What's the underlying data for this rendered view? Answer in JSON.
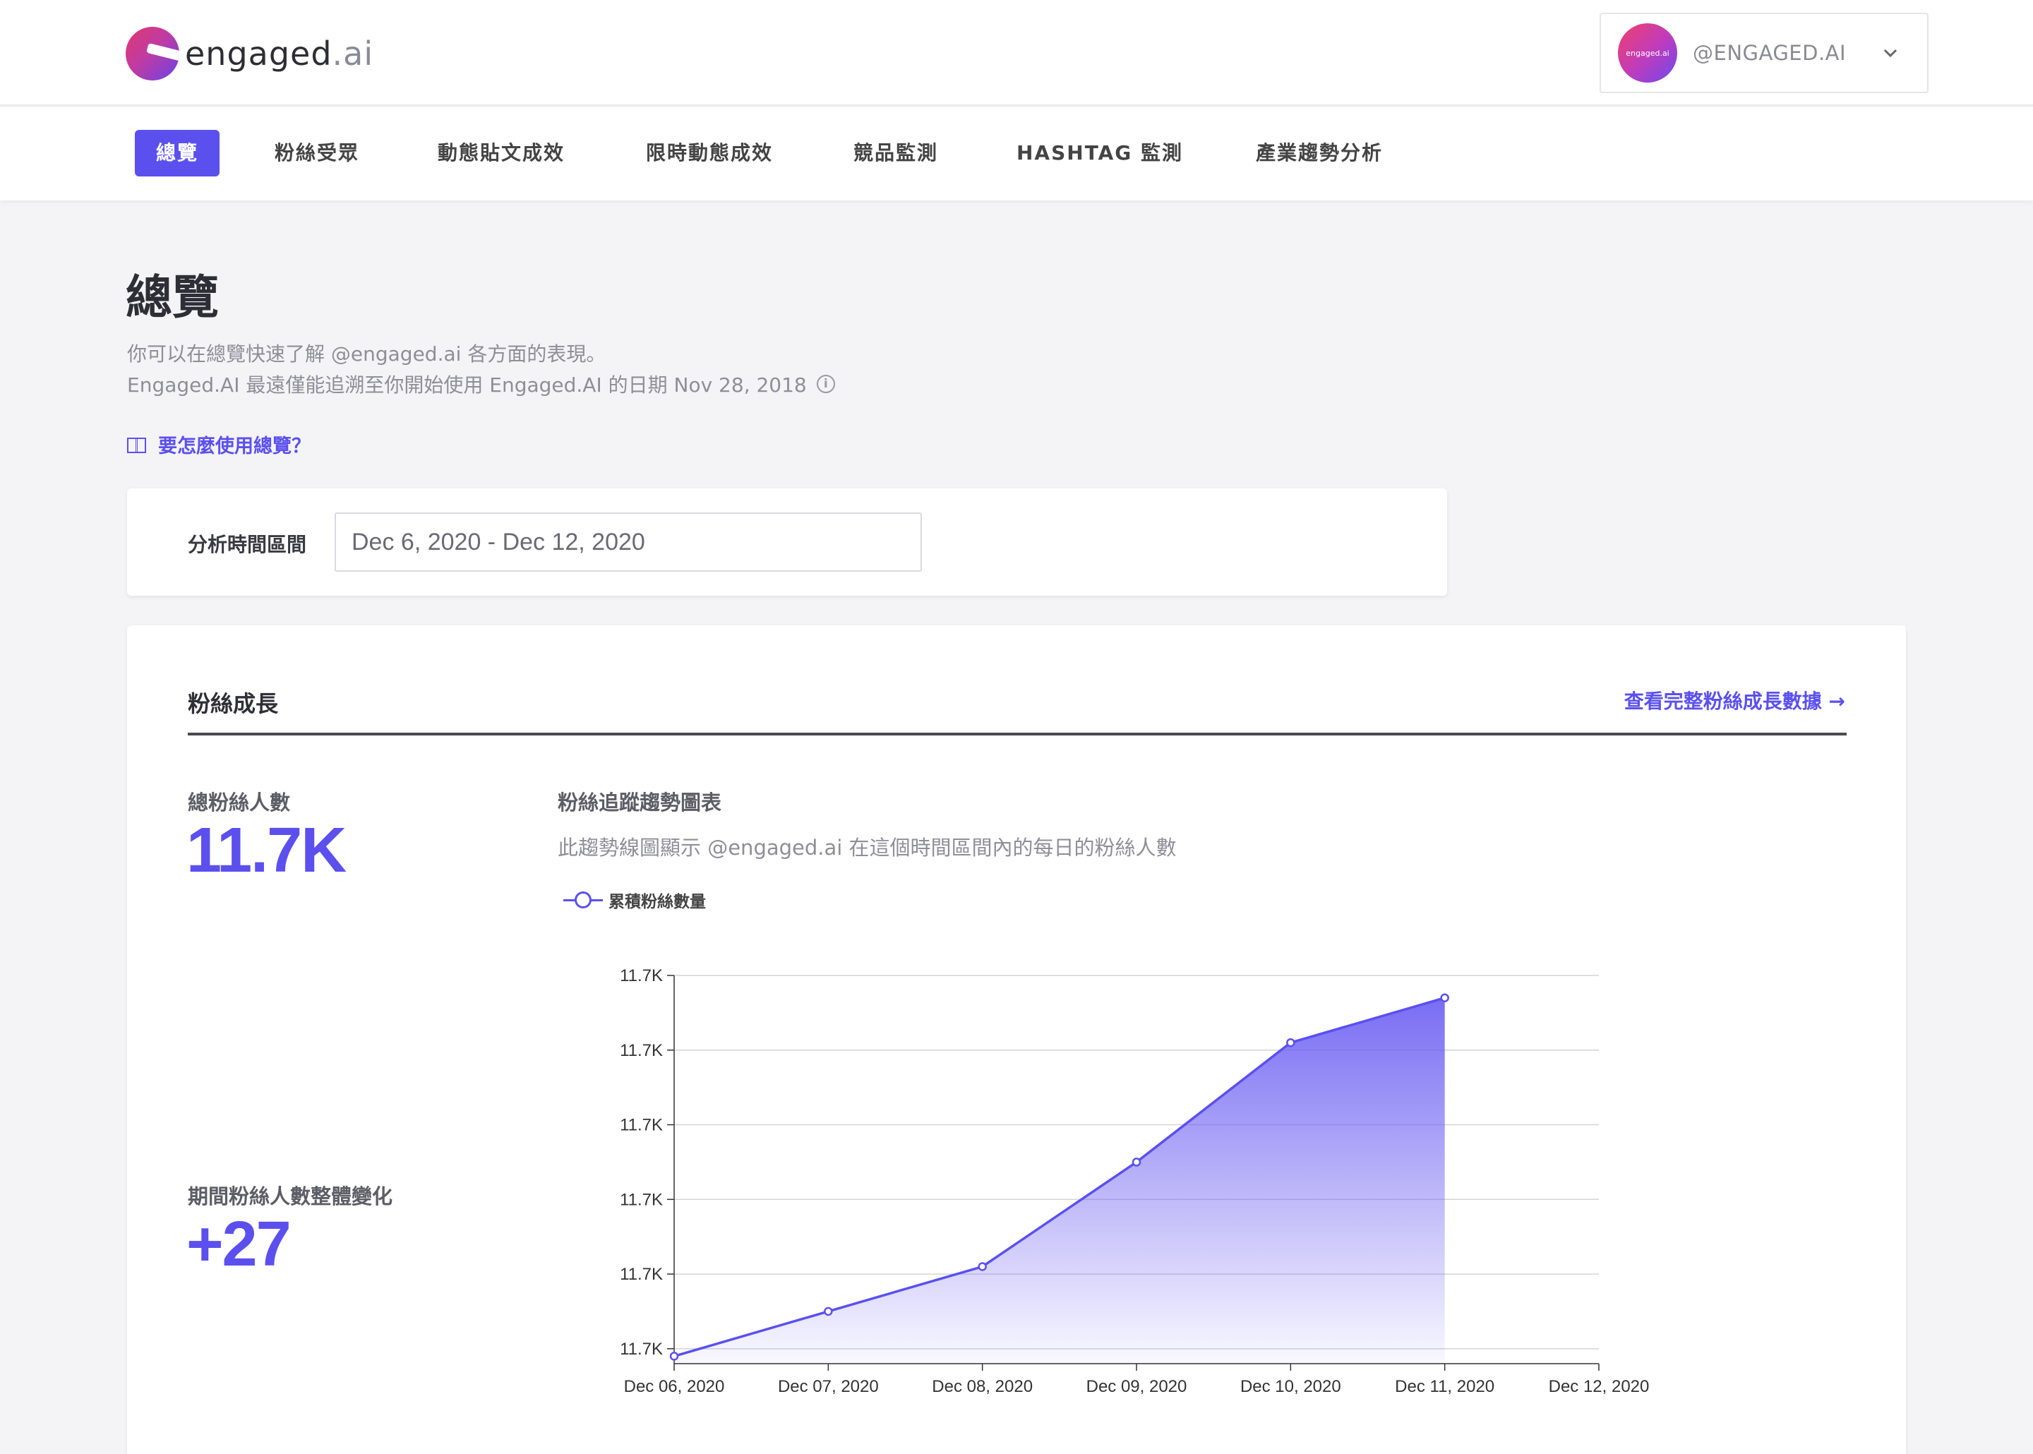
{
  "brand": {
    "logo_text": "engaged",
    "logo_suffix": ".ai"
  },
  "account": {
    "avatar_text": "engaged.ai",
    "name": "@ENGAGED.AI"
  },
  "nav": {
    "items": [
      {
        "label": "總覽"
      },
      {
        "label": "粉絲受眾"
      },
      {
        "label": "動態貼文成效"
      },
      {
        "label": "限時動態成效"
      },
      {
        "label": "競品監測"
      },
      {
        "label": "HASHTAG 監測"
      },
      {
        "label": "產業趨勢分析"
      }
    ]
  },
  "page": {
    "title": "總覽",
    "desc1": "你可以在總覽快速了解 @engaged.ai 各方面的表現。",
    "desc2": "Engaged.AI 最遠僅能追溯至你開始使用 Engaged.AI 的日期 Nov 28, 2018",
    "howto": "要怎麼使用總覽？"
  },
  "range": {
    "label": "分析時間區間",
    "value": "Dec 6, 2020 - Dec 12, 2020"
  },
  "growth": {
    "title": "粉絲成長",
    "link": "查看完整粉絲成長數據 →",
    "total_label": "總粉絲人數",
    "total_value": "11.7K",
    "change_label": "期間粉絲人數整體變化",
    "change_value": "+27",
    "chart_title": "粉絲追蹤趨勢圖表",
    "chart_sub": "此趨勢線圖顯示 @engaged.ai 在這個時間區間內的每日的粉絲人數"
  },
  "colors": {
    "accent": "#5b50ee"
  },
  "chart_data": {
    "type": "area",
    "x": [
      "Dec 06, 2020",
      "Dec 07, 2020",
      "Dec 08, 2020",
      "Dec 09, 2020",
      "Dec 10, 2020",
      "Dec 11, 2020",
      "Dec 12, 2020"
    ],
    "series": [
      {
        "name": "累積粉絲數量",
        "values": [
          11700,
          11706,
          11712,
          11726,
          11742,
          11748,
          null
        ]
      }
    ],
    "y_ticks": [
      "11.7K",
      "11.7K",
      "11.7K",
      "11.7K",
      "11.7K",
      "11.7K"
    ],
    "y_tick_values": [
      11701,
      11711,
      11721,
      11731,
      11741,
      11751
    ],
    "ylim": [
      11699,
      11751
    ],
    "grid": true,
    "legend": "top-left"
  }
}
